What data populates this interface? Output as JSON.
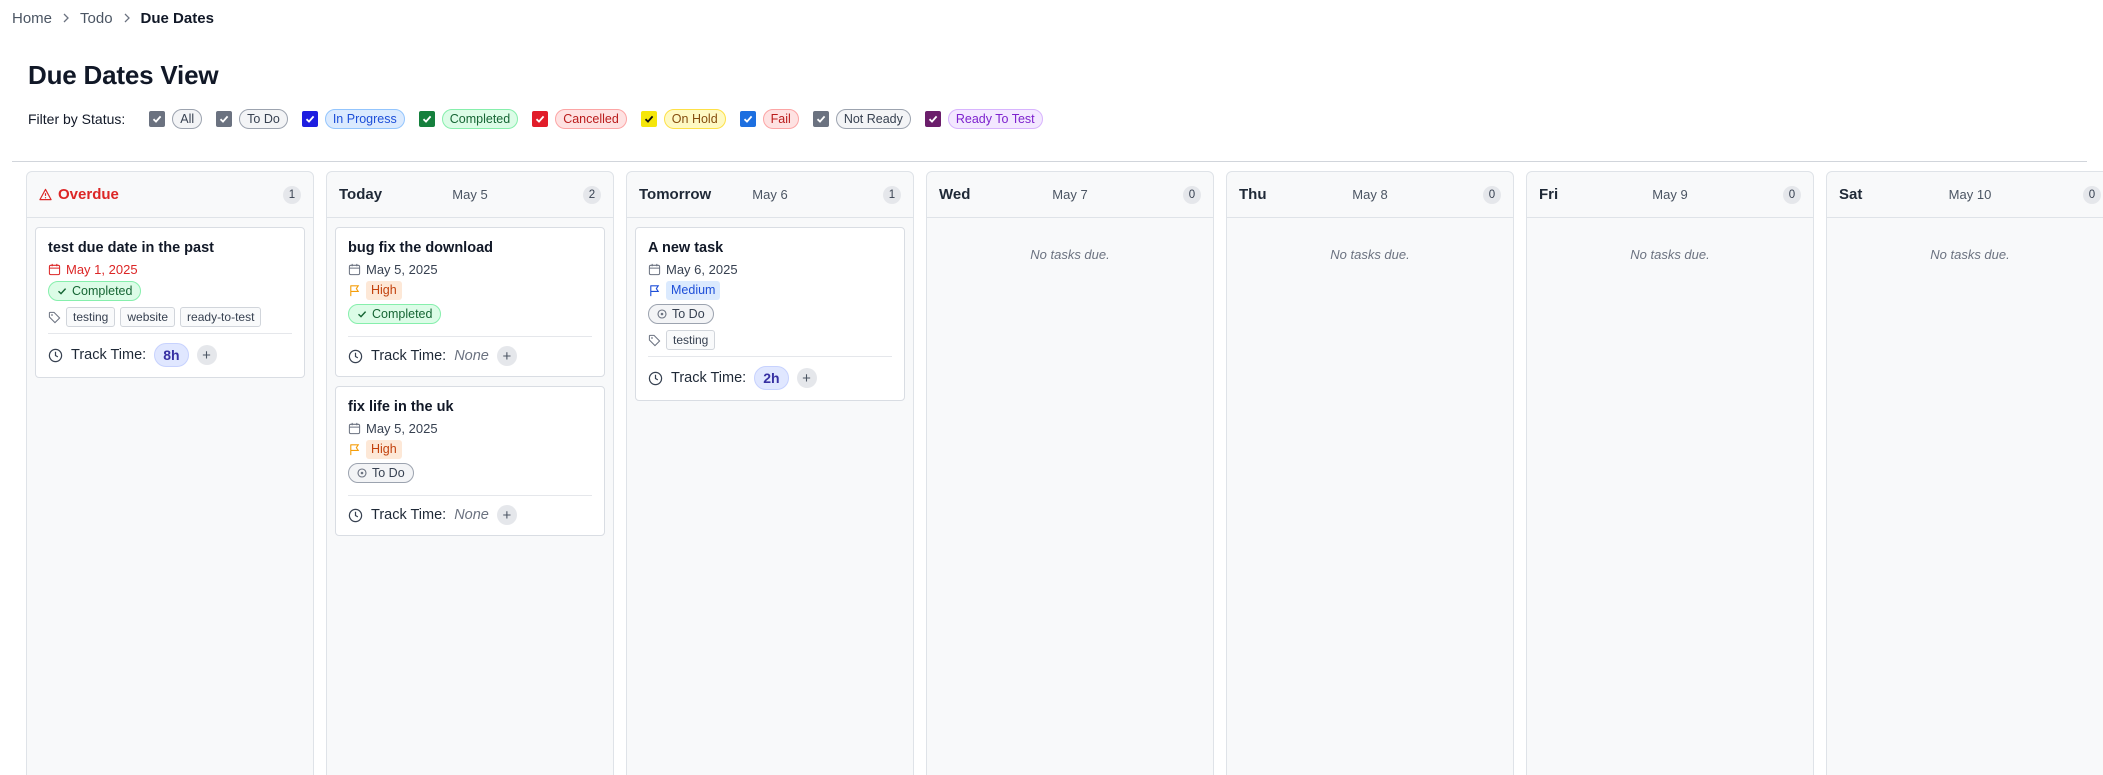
{
  "breadcrumb": {
    "items": [
      "Home",
      "Todo"
    ],
    "current": "Due Dates"
  },
  "title": "Due Dates View",
  "filter": {
    "label": "Filter by Status:",
    "options": [
      {
        "label": "All",
        "checkbox_color": "#6b7280",
        "bg": "#f3f4f6",
        "fg": "#374151",
        "border": "#9ca3af"
      },
      {
        "label": "To Do",
        "checkbox_color": "#6b7280",
        "bg": "#f3f4f6",
        "fg": "#374151",
        "border": "#9ca3af"
      },
      {
        "label": "In Progress",
        "checkbox_color": "#1e1ee0",
        "bg": "#dbeafe",
        "fg": "#1d4ed8",
        "border": "#93c5fd"
      },
      {
        "label": "Completed",
        "checkbox_color": "#15803d",
        "bg": "#dcfce7",
        "fg": "#166534",
        "border": "#86efac"
      },
      {
        "label": "Cancelled",
        "checkbox_color": "#e11d2a",
        "bg": "#fee2e2",
        "fg": "#b91c1c",
        "border": "#fca5a5"
      },
      {
        "label": "On Hold",
        "checkbox_color": "#f5e60a",
        "bg": "#fef9c3",
        "fg": "#854d0e",
        "border": "#fde047"
      },
      {
        "label": "Fail",
        "checkbox_color": "#1d6fe0",
        "bg": "#fee2e2",
        "fg": "#b91c1c",
        "border": "#fca5a5"
      },
      {
        "label": "Not Ready",
        "checkbox_color": "#6b7280",
        "bg": "#f3f4f6",
        "fg": "#374151",
        "border": "#9ca3af"
      },
      {
        "label": "Ready To Test",
        "checkbox_color": "#6b1e6b",
        "bg": "#f3e8ff",
        "fg": "#7e22ce",
        "border": "#d8b4fe"
      }
    ]
  },
  "columns": [
    {
      "name": "Overdue",
      "date": "",
      "count": "1",
      "overdue": true,
      "tasks": [
        {
          "title": "test due date in the past",
          "due": "May 1, 2025",
          "due_overdue": true,
          "priority": null,
          "status": "Completed",
          "status_type": "completed",
          "tags": [
            "testing",
            "website",
            "ready-to-test"
          ],
          "track_label": "Track Time:",
          "track_value": "8h"
        }
      ]
    },
    {
      "name": "Today",
      "date": "May 5",
      "count": "2",
      "tasks": [
        {
          "title": "bug fix the download",
          "due": "May 5, 2025",
          "priority": "High",
          "priority_type": "high",
          "status": "Completed",
          "status_type": "completed",
          "tags": [],
          "track_label": "Track Time:",
          "track_value": null,
          "track_none": "None"
        },
        {
          "title": "fix life in the uk",
          "due": "May 5, 2025",
          "priority": "High",
          "priority_type": "high",
          "status": "To Do",
          "status_type": "todo",
          "tags": [],
          "track_label": "Track Time:",
          "track_value": null,
          "track_none": "None"
        }
      ]
    },
    {
      "name": "Tomorrow",
      "date": "May 6",
      "count": "1",
      "tasks": [
        {
          "title": "A new task",
          "due": "May 6, 2025",
          "priority": "Medium",
          "priority_type": "medium",
          "status": "To Do",
          "status_type": "todo",
          "tags": [
            "testing"
          ],
          "track_label": "Track Time:",
          "track_value": "2h"
        }
      ]
    },
    {
      "name": "Wed",
      "date": "May 7",
      "count": "0",
      "tasks": [],
      "empty": "No tasks due."
    },
    {
      "name": "Thu",
      "date": "May 8",
      "count": "0",
      "tasks": [],
      "empty": "No tasks due."
    },
    {
      "name": "Fri",
      "date": "May 9",
      "count": "0",
      "tasks": [],
      "empty": "No tasks due."
    },
    {
      "name": "Sat",
      "date": "May 10",
      "count": "0",
      "tasks": [],
      "empty": "No tasks due."
    }
  ]
}
